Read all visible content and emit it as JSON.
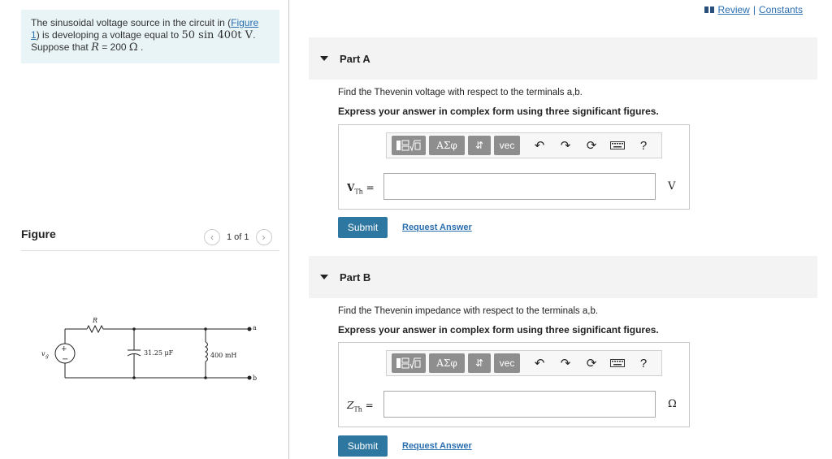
{
  "problem": {
    "text_1": "The sinusoidal voltage source in the circuit in (",
    "figure_link": "Figure 1",
    "text_2": ") is developing a voltage equal to ",
    "voltage_expr": "50 sin 400t V",
    "text_3": ".",
    "text_4": "Suppose that ",
    "r_expr": "R",
    "r_value": " = 200 ",
    "r_unit": "Ω",
    "text_5": " ."
  },
  "figure": {
    "label": "Figure",
    "pager": "1 of 1",
    "prev_icon": "chevron-left-icon",
    "next_icon": "chevron-right-icon",
    "circuit": {
      "source_label": "v",
      "source_sub": "g",
      "resistor_label": "R",
      "capacitor_label": "31.25 μF",
      "inductor_label": "400 mH",
      "terminal_a": "a",
      "terminal_b": "b"
    }
  },
  "header": {
    "review": "Review",
    "separator": "|",
    "constants": "Constants"
  },
  "parts": [
    {
      "title": "Part A",
      "question": "Find the Thevenin voltage with respect to the terminals a,b.",
      "instruction": "Express your answer in complex form using three significant figures.",
      "lhs_var": "V",
      "lhs_sub": "Th",
      "lhs_eq": " =",
      "input_value": "",
      "unit": "V",
      "submit": "Submit",
      "request": "Request Answer"
    },
    {
      "title": "Part B",
      "question": "Find the Thevenin impedance with respect to the terminals a,b.",
      "instruction": "Express your answer in complex form using three significant figures.",
      "lhs_var": "Z",
      "lhs_sub": "Th",
      "lhs_eq": " =",
      "input_value": "",
      "unit": "Ω",
      "submit": "Submit",
      "request": "Request Answer"
    }
  ],
  "toolbar": {
    "template_icon": "fraction-sqrt-template-icon",
    "greek": "ΑΣφ",
    "arrows": "⇵",
    "vec": "vec",
    "undo": "↶",
    "redo": "↷",
    "reset": "⟳",
    "keyboard_icon": "keyboard-icon",
    "help": "?"
  },
  "colors": {
    "accent": "#2e77a1",
    "link": "#2a6eb0",
    "problem_bg": "#e9f4f6",
    "part_header_bg": "#f3f3f3"
  }
}
